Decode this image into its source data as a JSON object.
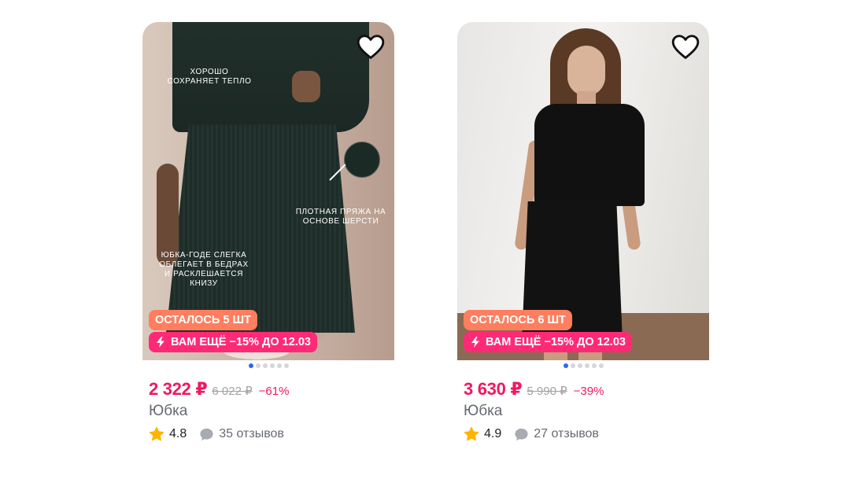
{
  "products": [
    {
      "photo_annotations": [
        "хорошо сохраняет тепло",
        "плотная пряжа на основе шерсти",
        "юбка-годе слегка облегает в бедрах и расклешается книзу"
      ],
      "stock_badge": "ОСТАЛОСЬ 5 ШТ",
      "promo_badge": "ВАМ ЕЩЁ −15% ДО 12.03",
      "price": "2 322 ₽",
      "old_price": "6 022 ₽",
      "discount": "−61%",
      "title": "Юбка",
      "rating": "4.8",
      "reviews": "35 отзывов",
      "gallery_active_index": 0,
      "gallery_count": 6
    },
    {
      "stock_badge": "ОСТАЛОСЬ 6 ШТ",
      "promo_badge": "ВАМ ЕЩЁ −15% ДО 12.03",
      "price": "3 630 ₽",
      "old_price": "5 990 ₽",
      "discount": "−39%",
      "title": "Юбка",
      "rating": "4.9",
      "reviews": "27 отзывов",
      "gallery_active_index": 0,
      "gallery_count": 6
    }
  ],
  "icons": {
    "favorite": "heart-outline-icon",
    "promo": "lightning-icon",
    "rating": "star-icon",
    "reviews": "speech-bubble-icon"
  },
  "colors": {
    "price": "#f0185e",
    "stock_badge": "#ff7e5f",
    "promo_badge": "#ff2a76",
    "star": "#ffb400",
    "active_dot": "#2b6be6"
  }
}
